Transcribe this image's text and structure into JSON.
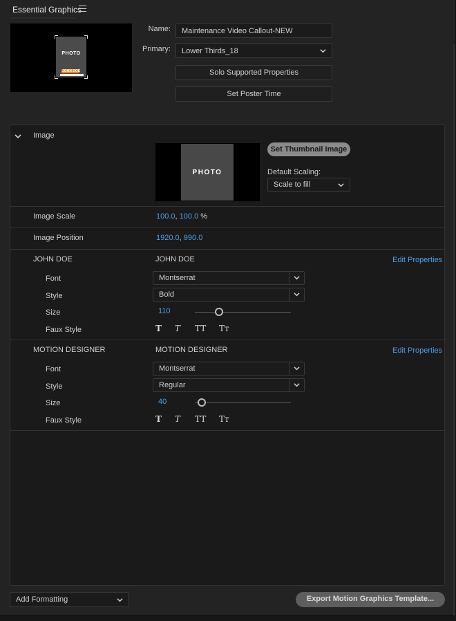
{
  "panel": {
    "title": "Essential Graphics",
    "menu_icon": "hamburger-menu-icon"
  },
  "thumbnail": {
    "photo_text": "PHOTO",
    "name_text": "JOHN DOE"
  },
  "template": {
    "name_label": "Name:",
    "name_value": "Maintenance Video Callout-NEW",
    "primary_label": "Primary:",
    "primary_value": "Lower Thirds_18",
    "solo_button": "Solo Supported Properties",
    "poster_button": "Set Poster Time"
  },
  "image_section": {
    "title": "Image",
    "preview_text": "PHOTO",
    "set_thumbnail_button": "Set Thumbnail Image",
    "default_scaling_label": "Default Scaling:",
    "default_scaling_value": "Scale to fill",
    "scale_label": "Image Scale",
    "scale_x": "100.0",
    "scale_sep": ",",
    "scale_y": "100.0",
    "scale_unit": "%",
    "position_label": "Image Position",
    "position_x": "1920.0",
    "position_sep": ",",
    "position_y": "990.0"
  },
  "text_layers": [
    {
      "layer_name": "JOHN DOE",
      "text_value": "JOHN DOE",
      "edit_link": "Edit Properties",
      "font_label": "Font",
      "font_value": "Montserrat",
      "style_label": "Style",
      "style_value": "Bold",
      "size_label": "Size",
      "size_value": "110",
      "faux_label": "Faux Style",
      "faux_bold": "T",
      "faux_italic": "T",
      "faux_allcaps": "TT",
      "faux_smallcaps": "Tт"
    },
    {
      "layer_name": "MOTION DESIGNER",
      "text_value": "MOTION DESIGNER",
      "edit_link": "Edit Properties",
      "font_label": "Font",
      "font_value": "Montserrat",
      "style_label": "Style",
      "style_value": "Regular",
      "size_label": "Size",
      "size_value": "40",
      "faux_label": "Faux Style",
      "faux_bold": "T",
      "faux_italic": "T",
      "faux_allcaps": "TT",
      "faux_smallcaps": "Tт"
    }
  ],
  "footer": {
    "add_formatting": "Add Formatting",
    "export_button": "Export Motion Graphics Template..."
  }
}
